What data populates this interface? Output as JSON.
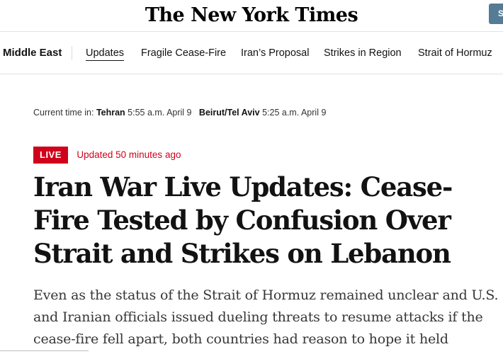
{
  "header": {
    "logo_text": "The New York Times",
    "corner_button_label": "S"
  },
  "nav": {
    "section": "Middle East",
    "links": [
      {
        "label": "Updates",
        "active": true
      },
      {
        "label": "Fragile Cease-Fire",
        "active": false
      },
      {
        "label": "Iran’s Proposal",
        "active": false
      },
      {
        "label": "Strikes in Region",
        "active": false
      },
      {
        "label": "Strait of Hormuz",
        "active": false
      }
    ]
  },
  "time": {
    "prefix": "Current time in:",
    "cities": [
      {
        "name": "Tehran",
        "time": "5:55 a.m. April 9"
      },
      {
        "name": "Beirut/Tel Aviv",
        "time": "5:25 a.m. April 9"
      }
    ]
  },
  "live": {
    "badge": "LIVE",
    "updated": "Updated 50 minutes ago"
  },
  "article": {
    "headline": "Iran War Live Updates: Cease-Fire Tested by Confusion Over Strait and Strikes on Lebanon",
    "summary": "Even as the status of the Strait of Hormuz remained unclear and U.S. and Iranian officials issued dueling threats to resume attacks if the cease-fire fell apart, both countries had reason to hope it held"
  },
  "colors": {
    "live_red": "#d0021b",
    "corner_button": "#567b95"
  }
}
